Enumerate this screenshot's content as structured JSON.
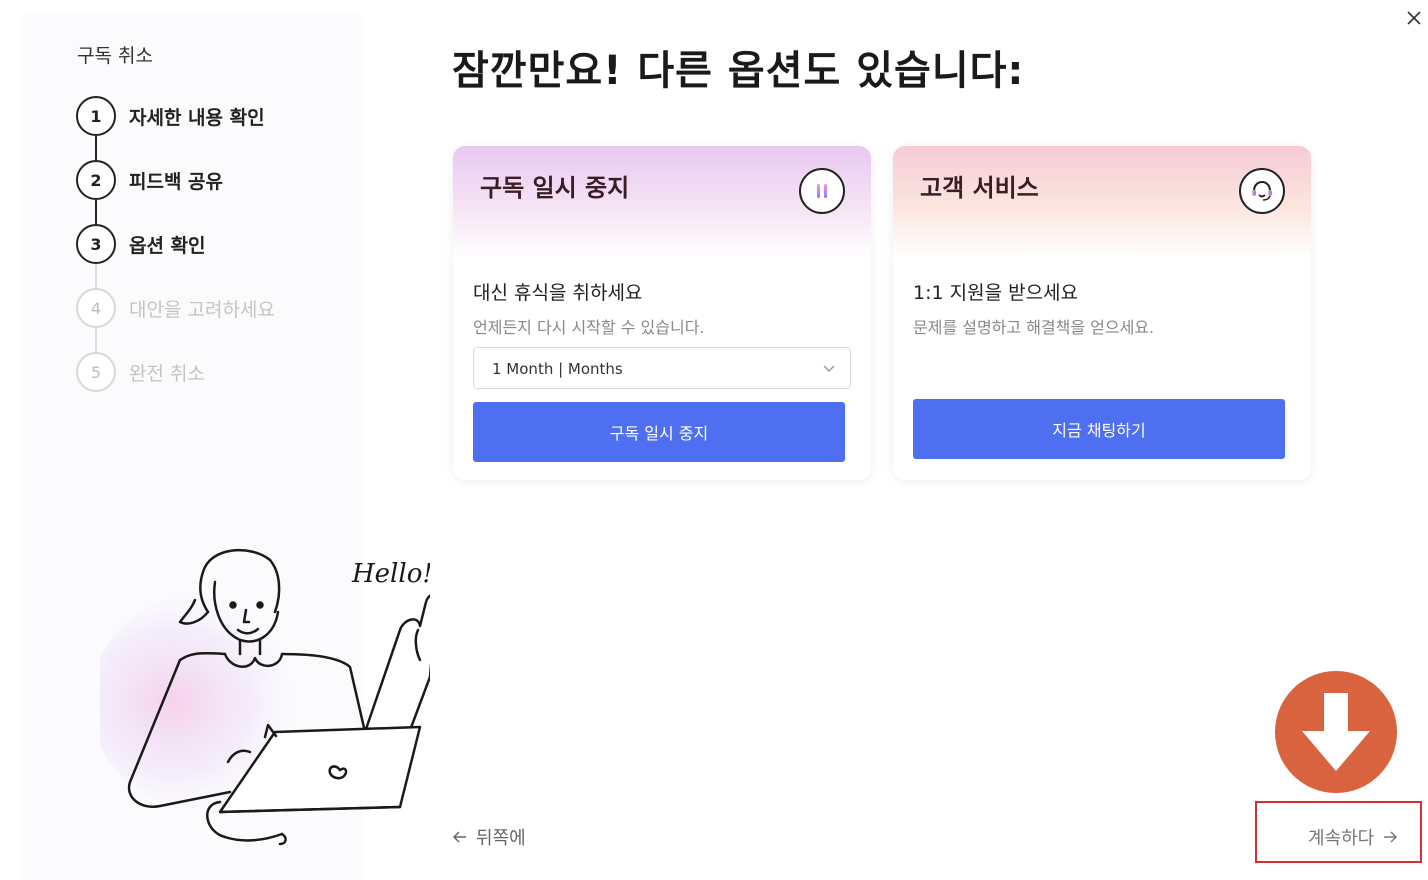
{
  "sidebar": {
    "title": "구독 취소",
    "steps": [
      {
        "number": "1",
        "label": "자세한 내용 확인"
      },
      {
        "number": "2",
        "label": "피드백 공유"
      },
      {
        "number": "3",
        "label": "옵션 확인"
      },
      {
        "number": "4",
        "label": "대안을 고려하세요"
      },
      {
        "number": "5",
        "label": "완전 취소"
      }
    ],
    "illustration_text": "Hello!"
  },
  "main": {
    "title": "잠깐만요! 다른 옵션도 있습니다:",
    "cards": [
      {
        "title": "구독 일시 중지",
        "icon": "pause-icon",
        "subtitle": "대신 휴식을 취하세요",
        "description": "언제든지 다시 시작할 수 있습니다.",
        "select_value": "1 Month | Months",
        "button_label": "구독 일시 중지"
      },
      {
        "title": "고객 서비스",
        "icon": "headset-icon",
        "subtitle": "1:1 지원을 받으세요",
        "description": "문제를 설명하고 해결책을 얻으세요.",
        "button_label": "지금 채팅하기"
      }
    ]
  },
  "footer": {
    "back_label": "뒤쪽에",
    "continue_label": "계속하다"
  },
  "colors": {
    "accent": "#4d6ff0",
    "highlight": "#d32f2f",
    "badge": "#d9633f"
  }
}
